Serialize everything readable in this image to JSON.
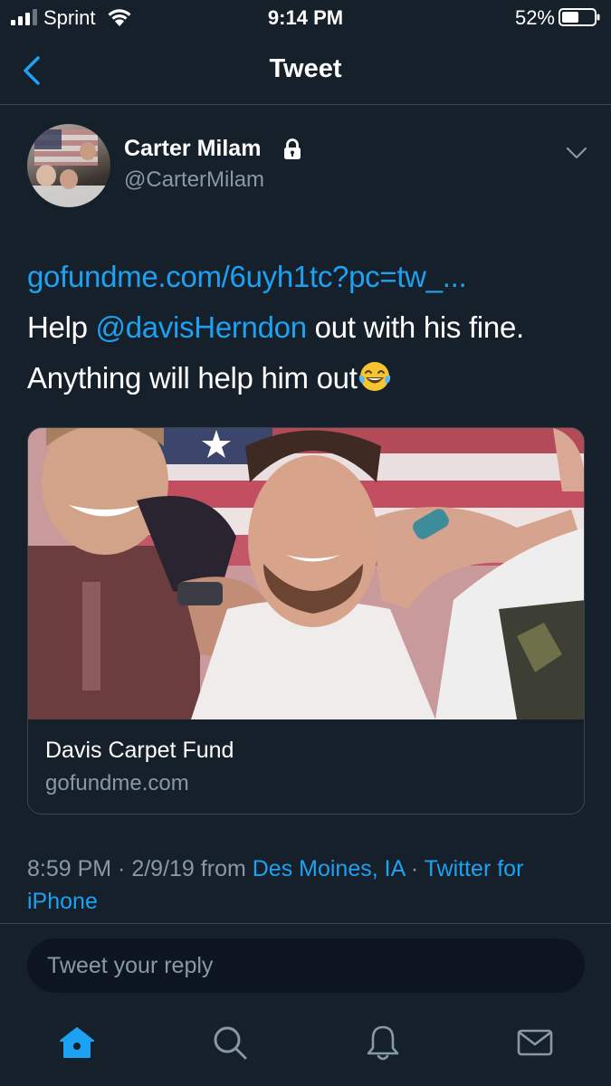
{
  "status_bar": {
    "carrier": "Sprint",
    "time": "9:14 PM",
    "battery": "52%"
  },
  "nav": {
    "title": "Tweet"
  },
  "author": {
    "name": "Carter Milam",
    "handle": "@CarterMilam"
  },
  "tweet": {
    "link": "gofundme.com/6uyh1tc?pc=tw_...",
    "line2_prefix": "Help ",
    "mention": "@davisHerndon",
    "line2_suffix": " out with his fine.",
    "line3": "Anything will help him out"
  },
  "card": {
    "title": "Davis Carpet Fund",
    "domain": "gofundme.com"
  },
  "meta": {
    "time": "8:59 PM",
    "date": "2/9/19",
    "from": "from",
    "location": "Des Moines, IA",
    "client": "Twitter for iPhone"
  },
  "reply": {
    "placeholder": "Tweet your reply"
  },
  "colors": {
    "background": "#15202b",
    "accent": "#1da1f2",
    "secondary_text": "#8899a6"
  }
}
